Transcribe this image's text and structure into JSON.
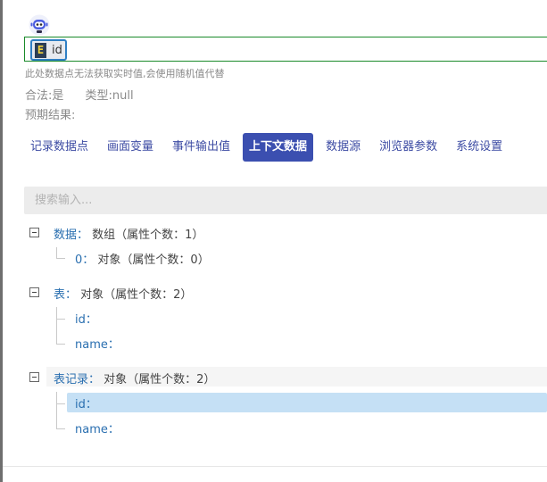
{
  "expression": {
    "chip_letter": "E",
    "chip_text": "id"
  },
  "hint": "此处数据点无法获取实时值,会使用随机值代替",
  "meta": {
    "valid": "合法:是",
    "type": "类型:null"
  },
  "expected": "预期结果:",
  "tabs": [
    {
      "label": "记录数据点"
    },
    {
      "label": "画面变量"
    },
    {
      "label": "事件输出值"
    },
    {
      "label": "上下文数据",
      "active": true
    },
    {
      "label": "数据源"
    },
    {
      "label": "浏览器参数"
    },
    {
      "label": "系统设置"
    }
  ],
  "search": {
    "placeholder": "搜索输入..."
  },
  "tree": [
    {
      "key": "数据：",
      "type": "数组（属性个数：1）",
      "children": [
        {
          "key": "0：",
          "type": "对象（属性个数：0）"
        }
      ]
    },
    {
      "key": "表：",
      "type": "对象（属性个数：2）",
      "children": [
        {
          "key": "id：",
          "type": ""
        },
        {
          "key": "name：",
          "type": ""
        }
      ]
    },
    {
      "key": "表记录：",
      "type": "对象（属性个数：2）",
      "children": [
        {
          "key": "id：",
          "type": "",
          "selected": true
        },
        {
          "key": "name：",
          "type": ""
        }
      ]
    }
  ],
  "colors": {
    "accent": "#3b4fb0",
    "tab_text": "#3c4ba3",
    "tree_key": "#2a6fb0",
    "selection": "#c5e0f5",
    "input_border": "#1a8a2a"
  },
  "icons": {
    "avatar": "robot-avatar-icon"
  }
}
